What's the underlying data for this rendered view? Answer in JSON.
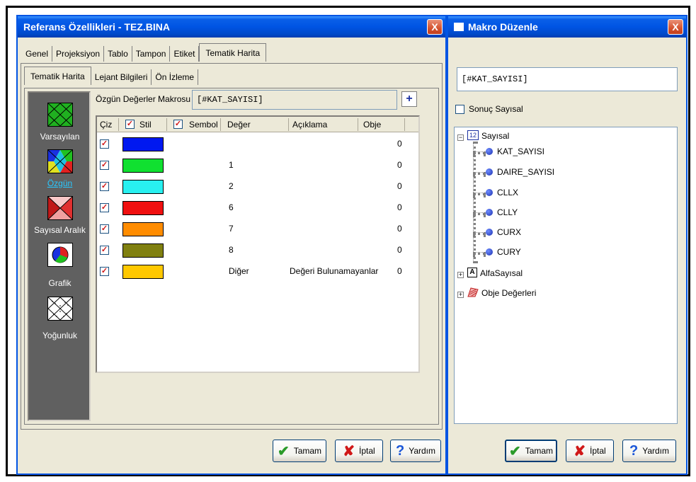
{
  "left_window": {
    "title": "Referans Özellikleri - TEZ.BINA",
    "close": "X",
    "tabs": [
      "Genel",
      "Projeksiyon",
      "Tablo",
      "Tampon",
      "Etiket",
      "Tematik Harita"
    ],
    "subtabs": [
      "Tematik Harita",
      "Lejant Bilgileri",
      "Ön İzleme"
    ],
    "sidebar": [
      "Varsayılan",
      "Özgün",
      "Sayısal Aralık",
      "Grafik",
      "Yoğunluk"
    ],
    "macro_label": "Özgün Değerler Makrosu",
    "macro_value": "[#KAT_SAYISI]",
    "plus": "+",
    "columns": {
      "ciz": "Çiz",
      "stil": "Stil",
      "sembol": "Sembol",
      "deger": "Değer",
      "aciklama": "Açıklama",
      "obje": "Obje"
    },
    "rows": [
      {
        "color": "#0018f0",
        "value": "",
        "desc": "",
        "obje": "0"
      },
      {
        "color": "#10e030",
        "value": "1",
        "desc": "",
        "obje": "0"
      },
      {
        "color": "#28f0f0",
        "value": "2",
        "desc": "",
        "obje": "0"
      },
      {
        "color": "#f01010",
        "value": "6",
        "desc": "",
        "obje": "0"
      },
      {
        "color": "#ff8c00",
        "value": "7",
        "desc": "",
        "obje": "0"
      },
      {
        "color": "#808010",
        "value": "8",
        "desc": "",
        "obje": "0"
      },
      {
        "color": "#ffc800",
        "value": "Diğer",
        "desc": "Değeri Bulunamayanlar",
        "obje": "0"
      }
    ],
    "buttons": {
      "ok": "Tamam",
      "cancel": "İptal",
      "help": "Yardım"
    }
  },
  "right_window": {
    "title": "Makro Düzenle",
    "close": "X",
    "macro_value": "[#KAT_SAYISI]",
    "checkbox_label": "Sonuç Sayısal",
    "tree": {
      "root_badge": "12",
      "root": "Sayısal",
      "children": [
        "KAT_SAYISI",
        "DAIRE_SAYISI",
        "CLLX",
        "CLLY",
        "CURX",
        "CURY"
      ],
      "alpha_badge": "A",
      "alpha": "AlfaSayısal",
      "obj": "Obje Değerleri"
    },
    "buttons": {
      "ok": "Tamam",
      "cancel": "İptal",
      "help": "Yardım"
    }
  }
}
